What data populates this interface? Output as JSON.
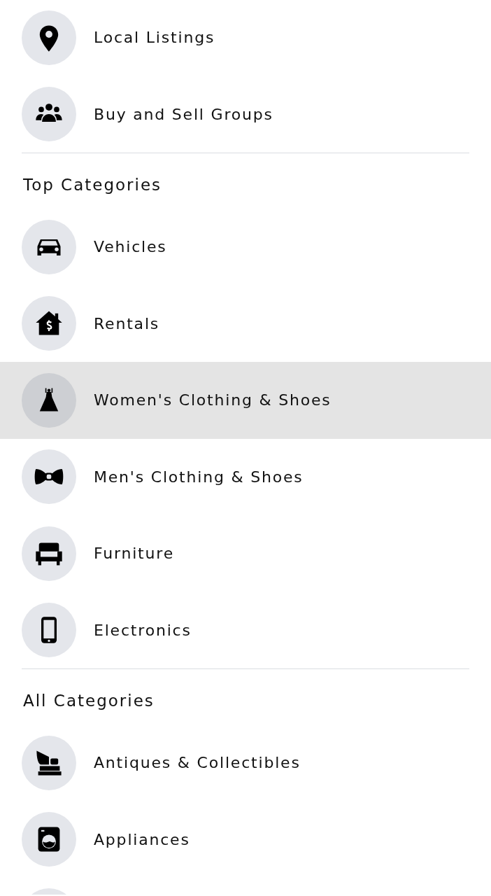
{
  "sections": [
    {
      "items": [
        {
          "label": "Local Listings",
          "kind": "pin",
          "selected": false
        },
        {
          "label": "Buy and Sell Groups",
          "kind": "group",
          "selected": false
        }
      ]
    },
    {
      "heading": "Top Categories",
      "items": [
        {
          "label": "Vehicles",
          "kind": "car",
          "selected": false
        },
        {
          "label": "Rentals",
          "kind": "house",
          "selected": false
        },
        {
          "label": "Women's Clothing & Shoes",
          "kind": "dress",
          "selected": true
        },
        {
          "label": "Men's Clothing & Shoes",
          "kind": "bowtie",
          "selected": false
        },
        {
          "label": "Furniture",
          "kind": "chair",
          "selected": false
        },
        {
          "label": "Electronics",
          "kind": "phone",
          "selected": false
        }
      ]
    },
    {
      "heading": "All Categories",
      "items": [
        {
          "label": "Antiques & Collectibles",
          "kind": "gramophone",
          "selected": false
        },
        {
          "label": "Appliances",
          "kind": "washer",
          "selected": false
        },
        {
          "kind": "cut"
        }
      ]
    }
  ]
}
